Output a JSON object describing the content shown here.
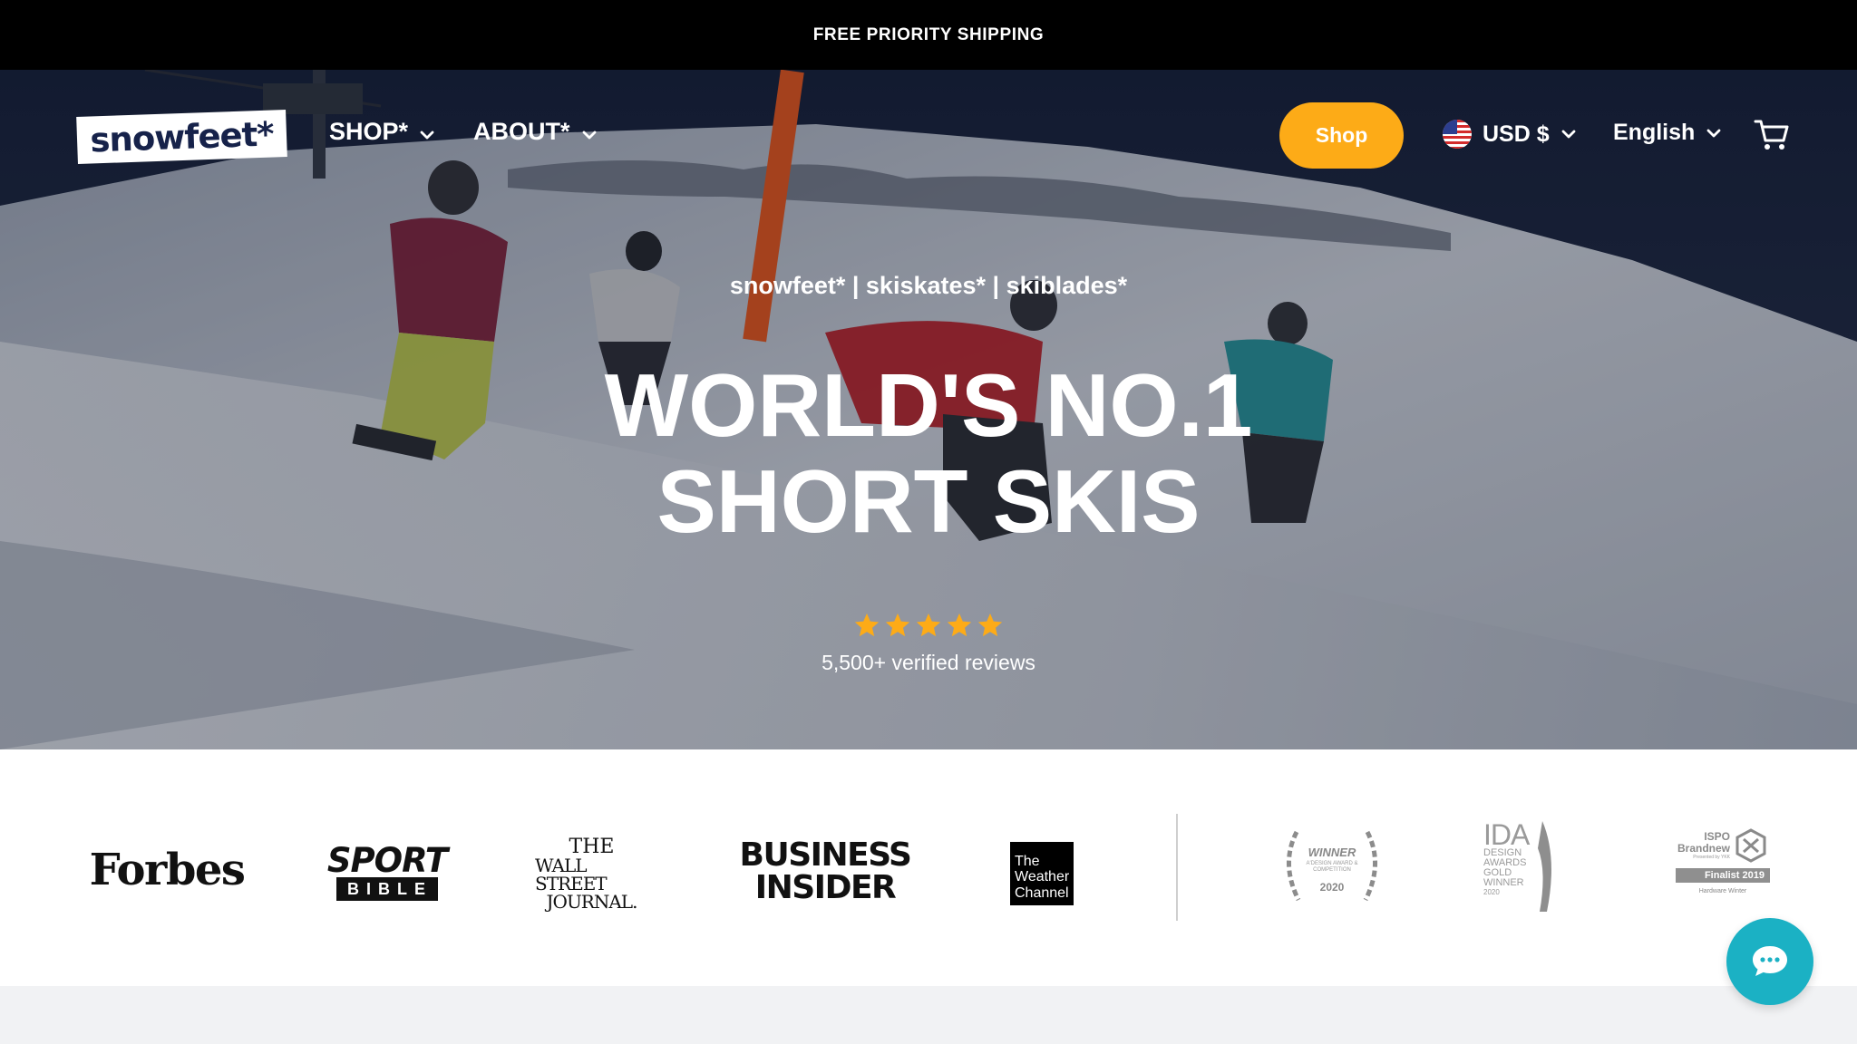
{
  "announcement": {
    "text": "FREE PRIORITY SHIPPING"
  },
  "nav": {
    "logo": "snowfeet*",
    "shop_menu": "SHOP*",
    "about_menu": "ABOUT*",
    "shop_button": "Shop",
    "currency": "USD $",
    "language": "English",
    "icons": {
      "cart": "cart-icon",
      "flag": "us-flag-icon",
      "chevron": "chevron-down-icon"
    }
  },
  "hero": {
    "tagline": "snowfeet* | skiskates* | skiblades*",
    "headline_line1": "WORLD'S NO.1",
    "headline_line2": "SHORT SKIS",
    "rating_stars": 5,
    "reviews": "5,500+ verified reviews"
  },
  "press": {
    "forbes": "Forbes",
    "sport": "SPORT",
    "bible": "BIBLE",
    "wsj_line1": "THE",
    "wsj_line2": "WALL STREET",
    "wsj_line3": "JOURNAL.",
    "bi_line1": "BUSINESS",
    "bi_line2": "INSIDER",
    "weather_line1": "The",
    "weather_line2": "Weather",
    "weather_line3": "Channel",
    "award1_title": "WINNER",
    "award1_sub": "A'DESIGN AWARD & COMPETITION",
    "award1_year": "2020",
    "award2_title": "IDA",
    "award2_sub1": "DESIGN",
    "award2_sub2": "AWARDS",
    "award2_sub3": "GOLD",
    "award2_sub4": "WINNER",
    "award2_year": "2020",
    "award3_title": "ISPO",
    "award3_sub": "Brandnew",
    "award3_presented": "Presented by YKK",
    "award3_finalist": "Finalist 2019",
    "award3_category": "Hardware Winter"
  },
  "colors": {
    "accent": "#fdab17",
    "chat": "#1bb1c4",
    "brand_navy": "#16224a"
  }
}
